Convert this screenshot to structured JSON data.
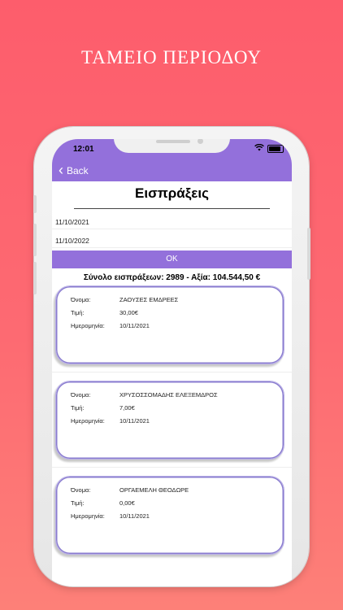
{
  "promo_title": "ΤΑΜΕΙΟ ΠΕΡΙΟΔΟΥ",
  "status_bar": {
    "time": "12:01"
  },
  "nav": {
    "back_label": "Back"
  },
  "page": {
    "title": "Εισπράξεις",
    "date_from": "11/10/2021",
    "date_to": "11/10/2022",
    "ok_label": "OK",
    "summary": "Σύνολο εισπράξεων: 2989 - Αξία: 104.544,50 €"
  },
  "labels": {
    "name": "Όνομα:",
    "price": "Τιμή:",
    "date": "Ημερομηνία:"
  },
  "records": [
    {
      "name": "ΖΑΟΥΣΕΣ ΕΜΔΡΕΕΣ",
      "price": "30,00€",
      "date": "10/11/2021"
    },
    {
      "name": "ΧΡΥΣΟΣΣΟΜΑΔΗΣ ΕΛΕΞΕΜΔΡΟΣ",
      "price": "7,00€",
      "date": "10/11/2021"
    },
    {
      "name": "ΟΡΓΑΕΜΕΛΗ ΘΕΟΔΩΡΕ",
      "price": "0,00€",
      "date": "10/11/2021"
    }
  ],
  "colors": {
    "accent": "#9370db",
    "background": "#fd5d6c"
  }
}
